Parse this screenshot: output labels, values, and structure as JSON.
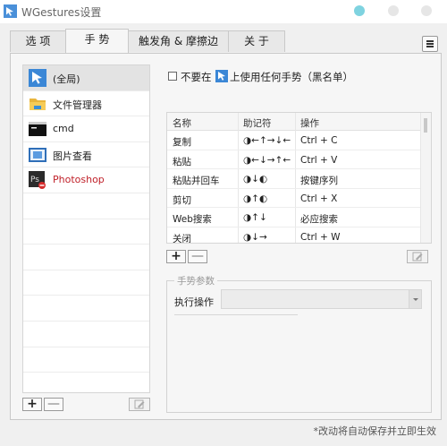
{
  "window": {
    "title": "WGestures设置"
  },
  "tabs": [
    {
      "label": "选 项",
      "active": false
    },
    {
      "label": "手 势",
      "active": true
    },
    {
      "label": "触发角 & 摩擦边",
      "active": false
    },
    {
      "label": "关 于",
      "active": false
    }
  ],
  "apps": [
    {
      "label": "(全局)",
      "icon": "wgestures-cursor-icon",
      "selected": true,
      "highlight": false
    },
    {
      "label": "文件管理器",
      "icon": "folder-icon",
      "selected": false,
      "highlight": false
    },
    {
      "label": "cmd",
      "icon": "terminal-icon",
      "selected": false,
      "highlight": false
    },
    {
      "label": "图片查看",
      "icon": "image-viewer-icon",
      "selected": false,
      "highlight": false
    },
    {
      "label": "Photoshop",
      "icon": "photoshop-icon",
      "selected": false,
      "highlight": true
    }
  ],
  "blacklist": {
    "checked": false,
    "text_before": "不要在",
    "text_after": "上使用任何手势（黑名单）"
  },
  "table": {
    "headers": [
      "名称",
      "助记符",
      "操作"
    ],
    "rows": [
      {
        "name": "复制",
        "mnemonic": "◑←↑→↓←",
        "action": "Ctrl + C"
      },
      {
        "name": "粘贴",
        "mnemonic": "◑←↓→↑←",
        "action": "Ctrl + V"
      },
      {
        "name": "粘贴并回车",
        "mnemonic": "◑↓◐",
        "action": "按键序列"
      },
      {
        "name": "剪切",
        "mnemonic": "◑↑◐",
        "action": "Ctrl + X"
      },
      {
        "name": "Web搜索",
        "mnemonic": "◑↑↓",
        "action": "必应搜索"
      },
      {
        "name": "关闭",
        "mnemonic": "◑↓→",
        "action": "Ctrl + W"
      }
    ]
  },
  "buttons": {
    "add": "+",
    "remove": "—"
  },
  "params": {
    "legend": "手势参数",
    "action_label": "执行操作",
    "action_value": ""
  },
  "footer": {
    "note": "*改动将自动保存并立即生效"
  },
  "colors": {
    "accent": "#7fd3e0",
    "photoshop_text": "#c0212a"
  }
}
